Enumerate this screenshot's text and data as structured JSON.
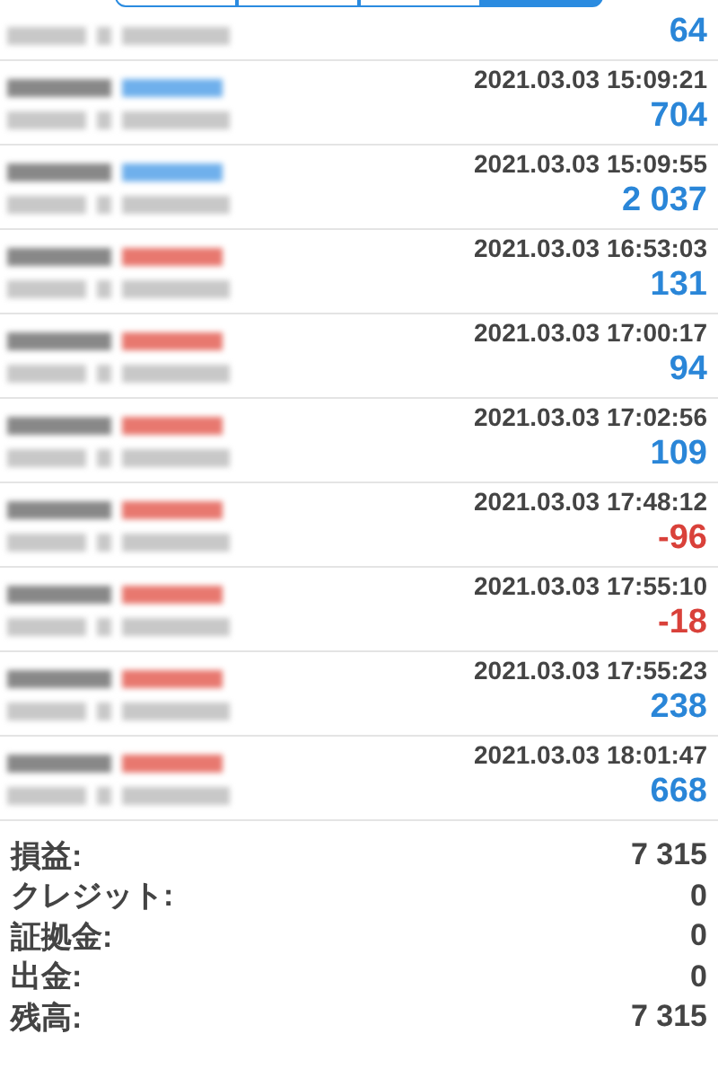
{
  "segments": [
    {
      "selected": false
    },
    {
      "selected": false
    },
    {
      "selected": false
    },
    {
      "selected": true
    }
  ],
  "trades": [
    {
      "profit": "64",
      "loss": false
    },
    {
      "kind": "buy",
      "time": "2021.03.03 15:09:21",
      "profit": "704",
      "loss": false
    },
    {
      "kind": "buy",
      "time": "2021.03.03 15:09:55",
      "profit": "2 037",
      "loss": false
    },
    {
      "kind": "sell",
      "time": "2021.03.03 16:53:03",
      "profit": "131",
      "loss": false
    },
    {
      "kind": "sell",
      "time": "2021.03.03 17:00:17",
      "profit": "94",
      "loss": false
    },
    {
      "kind": "sell",
      "time": "2021.03.03 17:02:56",
      "profit": "109",
      "loss": false
    },
    {
      "kind": "sell",
      "time": "2021.03.03 17:48:12",
      "profit": "-96",
      "loss": true
    },
    {
      "kind": "sell",
      "time": "2021.03.03 17:55:10",
      "profit": "-18",
      "loss": true
    },
    {
      "kind": "sell",
      "time": "2021.03.03 17:55:23",
      "profit": "238",
      "loss": false
    },
    {
      "kind": "sell",
      "time": "2021.03.03 18:01:47",
      "profit": "668",
      "loss": false
    }
  ],
  "summary": [
    {
      "label": "損益:",
      "value": "7 315"
    },
    {
      "label": "クレジット:",
      "value": "0"
    },
    {
      "label": "証拠金:",
      "value": "0"
    },
    {
      "label": "出金:",
      "value": "0"
    },
    {
      "label": "残高:",
      "value": "7 315"
    }
  ]
}
